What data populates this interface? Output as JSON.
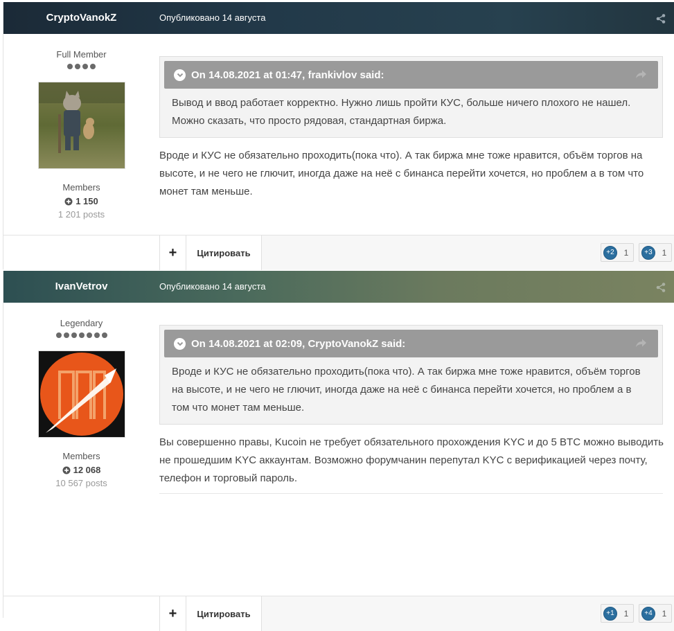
{
  "posts": [
    {
      "author": "CryptoVanokZ",
      "published": "Опубликовано 14 августа",
      "rank": "Full Member",
      "rank_pips": 4,
      "group": "Members",
      "reputation": "1 150",
      "post_count": "1 201 posts",
      "quote": {
        "header": "On 14.08.2021 at 01:47, frankivlov said:",
        "text": "Вывод и ввод работает корректно. Нужно лишь пройти КУС, больше ничего плохого не нашел. Можно сказать, что просто рядовая, стандартная биржа."
      },
      "text": "Вроде и КУС не обязательно проходить(пока что). А так биржа мне тоже нравится, объём торгов на высоте, и не чего не глючит, иногда даже на неё с бинанса перейти хочется, но проблем а в том что монет там меньше.",
      "footer": {
        "plus_label": "+",
        "quote_label": "Цитировать",
        "reactions": [
          {
            "badge": "+2",
            "count": "1"
          },
          {
            "badge": "+3",
            "count": "1"
          }
        ]
      }
    },
    {
      "author": "IvanVetrov",
      "published": "Опубликовано 14 августа",
      "rank": "Legendary",
      "rank_pips": 7,
      "group": "Members",
      "reputation": "12 068",
      "post_count": "10 567 posts",
      "quote": {
        "header": "On 14.08.2021 at 02:09, CryptoVanokZ said:",
        "text": "Вроде и КУС не обязательно проходить(пока что). А так биржа мне тоже нравится, объём торгов на высоте, и не чего не глючит, иногда даже на неё с бинанса перейти хочется, но проблем а в том что монет там меньше."
      },
      "text": "Вы совершенно правы, Kucoin не требует обязательного прохождения KYC и до 5 BTC можно выводить не прошедшим KYC аккаунтам. Возможно форумчанин перепутал KYC с верификацией через почту, телефон и торговый пароль.",
      "footer": {
        "plus_label": "+",
        "quote_label": "Цитировать",
        "reactions": [
          {
            "badge": "+1",
            "count": "1"
          },
          {
            "badge": "+4",
            "count": "1"
          }
        ]
      }
    }
  ],
  "icons": {
    "share": "share-icon",
    "reputation": "plus-circle-icon",
    "quote_toggle": "chevron-down-icon",
    "quote_share": "arrow-share-icon"
  },
  "colors": {
    "reaction_badge": "#2b6e9e",
    "quote_header": "#9a9a9a"
  }
}
